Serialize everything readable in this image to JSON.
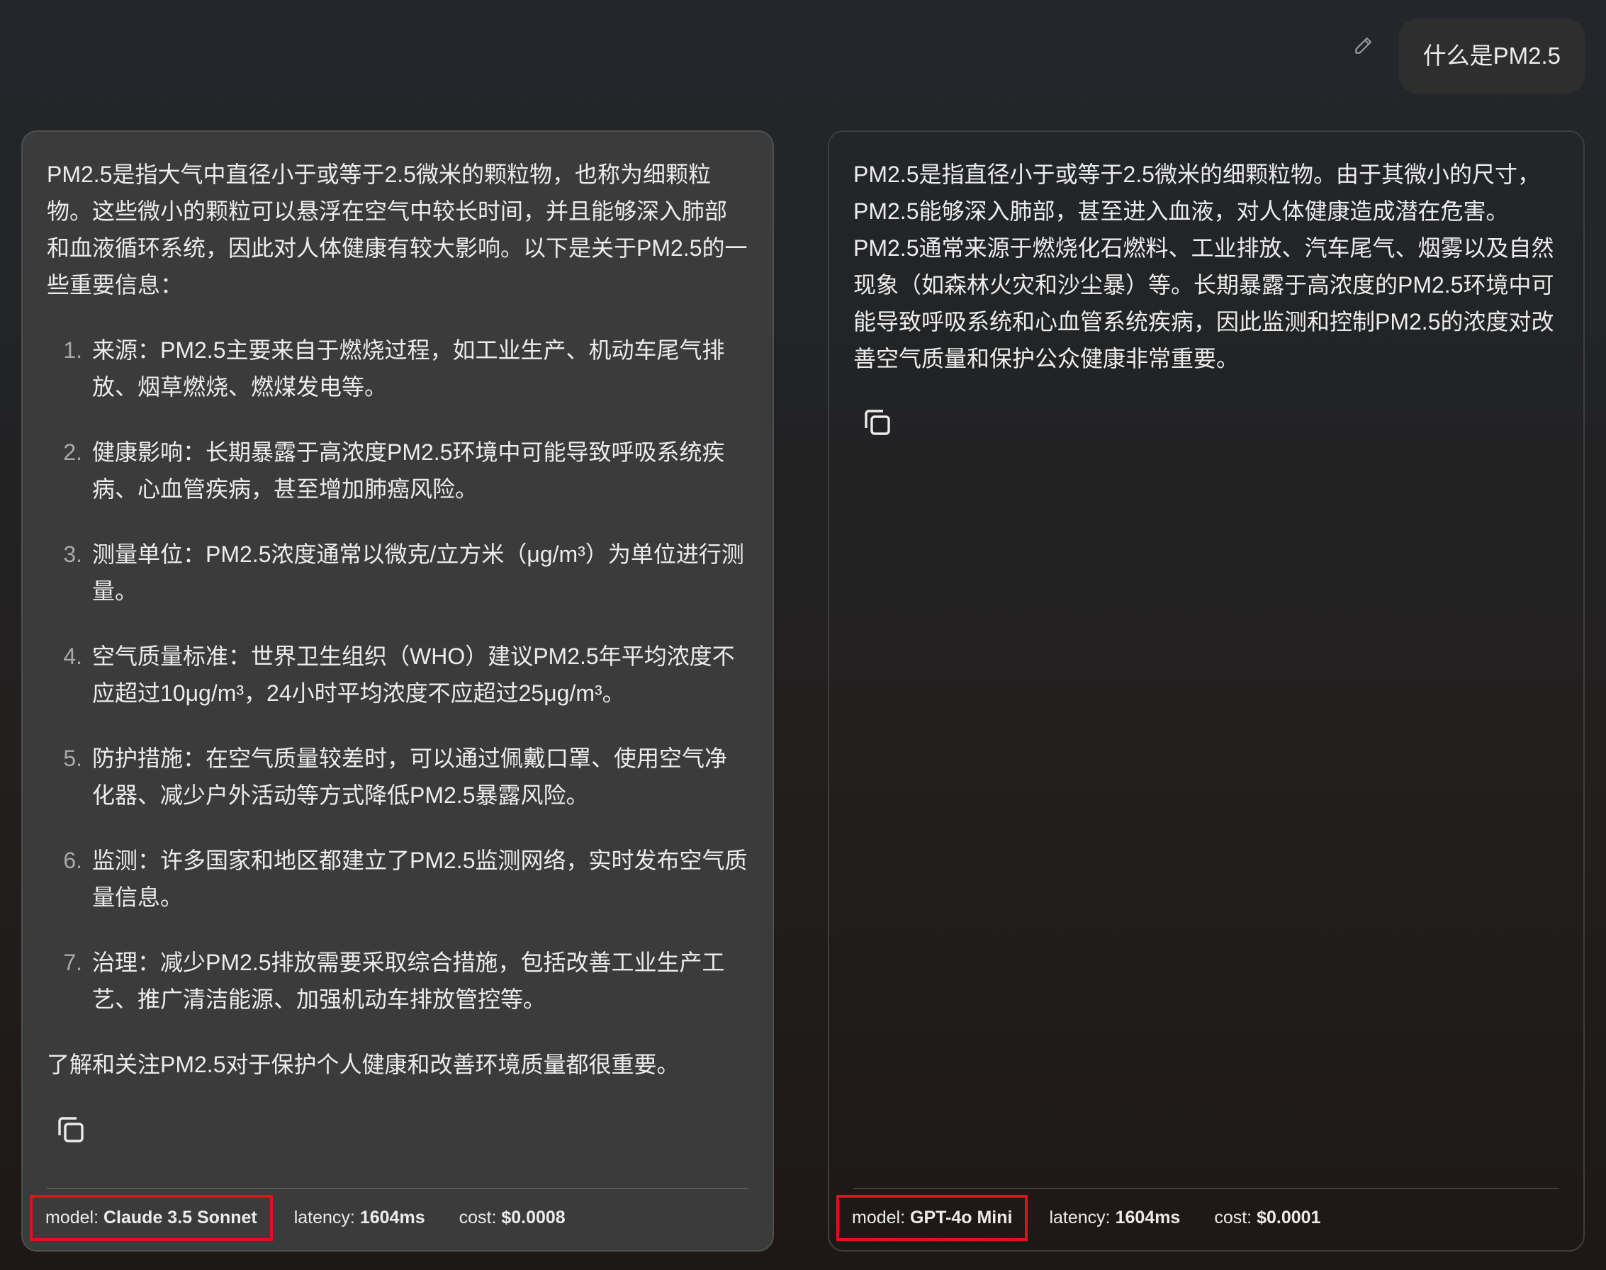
{
  "user_message": {
    "text": "什么是PM2.5"
  },
  "left_panel": {
    "intro": "PM2.5是指大气中直径小于或等于2.5微米的颗粒物，也称为细颗粒物。这些微小的颗粒可以悬浮在空气中较长时间，并且能够深入肺部和血液循环系统，因此对人体健康有较大影响。以下是关于PM2.5的一些重要信息：",
    "items": [
      {
        "num": "1.",
        "text": "来源：PM2.5主要来自于燃烧过程，如工业生产、机动车尾气排放、烟草燃烧、燃煤发电等。"
      },
      {
        "num": "2.",
        "text": "健康影响：长期暴露于高浓度PM2.5环境中可能导致呼吸系统疾病、心血管疾病，甚至增加肺癌风险。"
      },
      {
        "num": "3.",
        "text": "测量单位：PM2.5浓度通常以微克/立方米（μg/m³）为单位进行测量。"
      },
      {
        "num": "4.",
        "text": "空气质量标准：世界卫生组织（WHO）建议PM2.5年平均浓度不应超过10μg/m³，24小时平均浓度不应超过25μg/m³。"
      },
      {
        "num": "5.",
        "text": "防护措施：在空气质量较差时，可以通过佩戴口罩、使用空气净化器、减少户外活动等方式降低PM2.5暴露风险。"
      },
      {
        "num": "6.",
        "text": "监测：许多国家和地区都建立了PM2.5监测网络，实时发布空气质量信息。"
      },
      {
        "num": "7.",
        "text": "治理：减少PM2.5排放需要采取综合措施，包括改善工业生产工艺、推广清洁能源、加强机动车排放管控等。"
      }
    ],
    "outro": "了解和关注PM2.5对于保护个人健康和改善环境质量都很重要。",
    "meta": {
      "model_label": "model:",
      "model_value": "Claude 3.5 Sonnet",
      "latency_label": "latency:",
      "latency_value": "1604ms",
      "cost_label": "cost:",
      "cost_value": "$0.0008"
    }
  },
  "right_panel": {
    "text": "PM2.5是指直径小于或等于2.5微米的细颗粒物。由于其微小的尺寸，PM2.5能够深入肺部，甚至进入血液，对人体健康造成潜在危害。PM2.5通常来源于燃烧化石燃料、工业排放、汽车尾气、烟雾以及自然现象（如森林火灾和沙尘暴）等。长期暴露于高浓度的PM2.5环境中可能导致呼吸系统和心血管系统疾病，因此监测和控制PM2.5的浓度对改善空气质量和保护公众健康非常重要。",
    "meta": {
      "model_label": "model:",
      "model_value": "GPT-4o Mini",
      "latency_label": "latency:",
      "latency_value": "1604ms",
      "cost_label": "cost:",
      "cost_value": "$0.0001"
    }
  },
  "icons": {
    "edit": "pencil-icon",
    "copy": "copy-icon"
  },
  "colors": {
    "highlight_box": "#e0111b",
    "left_panel_bg": "#3b3b3b",
    "user_bubble_bg": "#2e2e2e"
  }
}
